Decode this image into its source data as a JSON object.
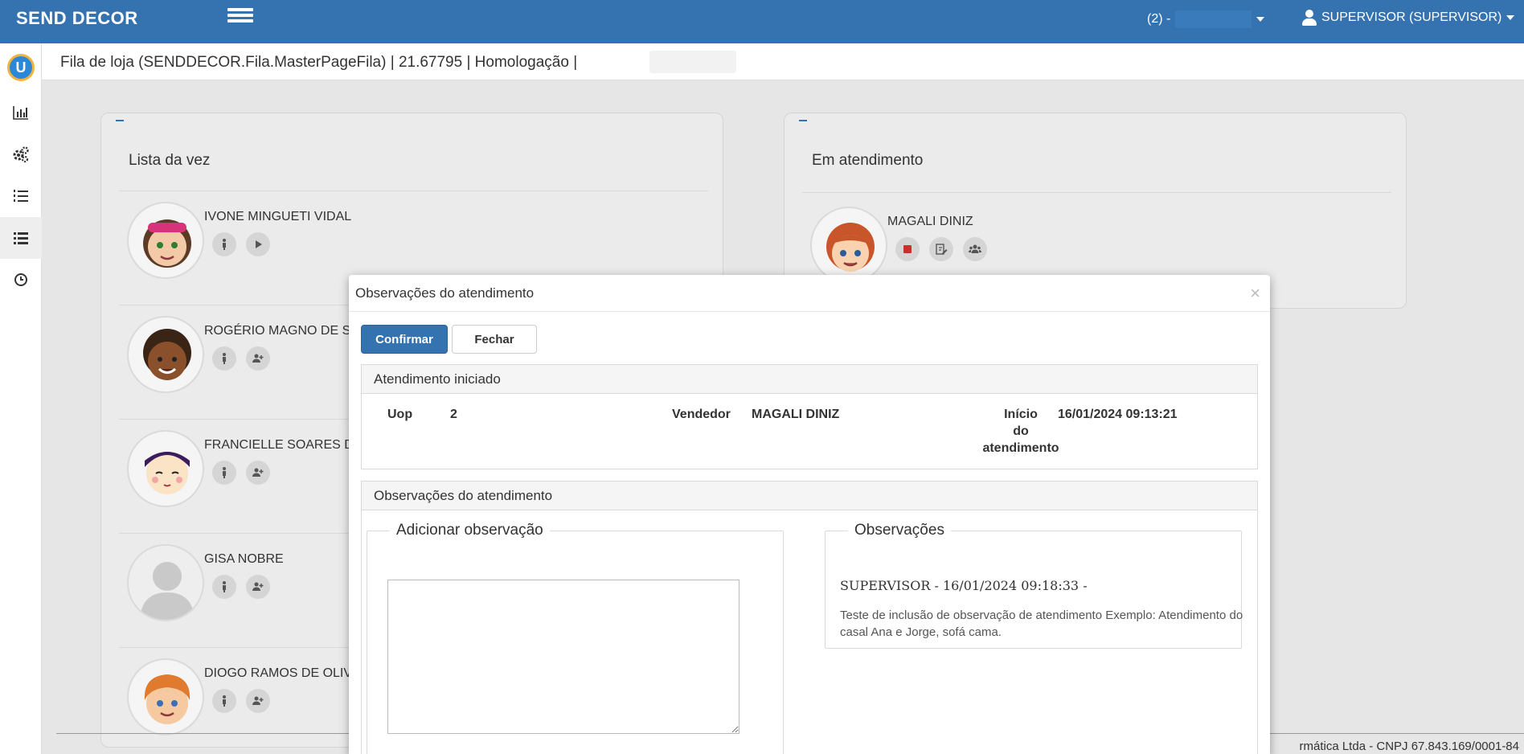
{
  "app": {
    "brand": "SEND DECOR",
    "store_selector": "(2) -",
    "user_label": "SUPERVISOR (SUPERVISOR)"
  },
  "page": {
    "title": "Fila de loja (SENDDECOR.Fila.MasterPageFila) | 21.67795 | Homologação |"
  },
  "sidebar": {
    "items": [
      {
        "icon": "logo-icon"
      },
      {
        "icon": "bar-chart-icon"
      },
      {
        "icon": "gears-icon"
      },
      {
        "icon": "list-ordered-icon"
      },
      {
        "icon": "list-icon"
      },
      {
        "icon": "clock-icon"
      }
    ]
  },
  "queue_panel": {
    "title": "Lista da vez",
    "people": [
      {
        "name": "IVONE MINGUETI VIDAL"
      },
      {
        "name": "ROGÉRIO MAGNO DE SC"
      },
      {
        "name": "FRANCIELLE SOARES DIA"
      },
      {
        "name": "GISA NOBRE"
      },
      {
        "name": "DIOGO RAMOS DE OLIVE"
      }
    ]
  },
  "service_panel": {
    "title": "Em atendimento",
    "people": [
      {
        "name": "MAGALI DINIZ"
      }
    ]
  },
  "footer": {
    "text": "rmática Ltda - CNPJ 67.843.169/0001-84"
  },
  "modal": {
    "title": "Observações do atendimento",
    "close": "×",
    "confirm_label": "Confirmar",
    "close_label": "Fechar",
    "started": {
      "heading": "Atendimento iniciado",
      "uop_label": "Uop",
      "uop_value": "2",
      "seller_label": "Vendedor",
      "seller_value": "MAGALI DINIZ",
      "start_label_1": "Início",
      "start_label_2": "do",
      "start_label_3": "atendimento",
      "start_value": "16/01/2024 09:13:21"
    },
    "notes": {
      "heading": "Observações do atendimento",
      "add_legend": "Adicionar observação",
      "add_value": "",
      "list_legend": "Observações",
      "entry_header": "SUPERVISOR - 16/01/2024 09:18:33 -",
      "entry_body": "Teste de inclusão de observação de atendimento Exemplo: Atendimento do casal Ana e Jorge, sofá cama."
    }
  },
  "colors": {
    "primary": "#3473b0",
    "stop_red": "#c9302c"
  }
}
